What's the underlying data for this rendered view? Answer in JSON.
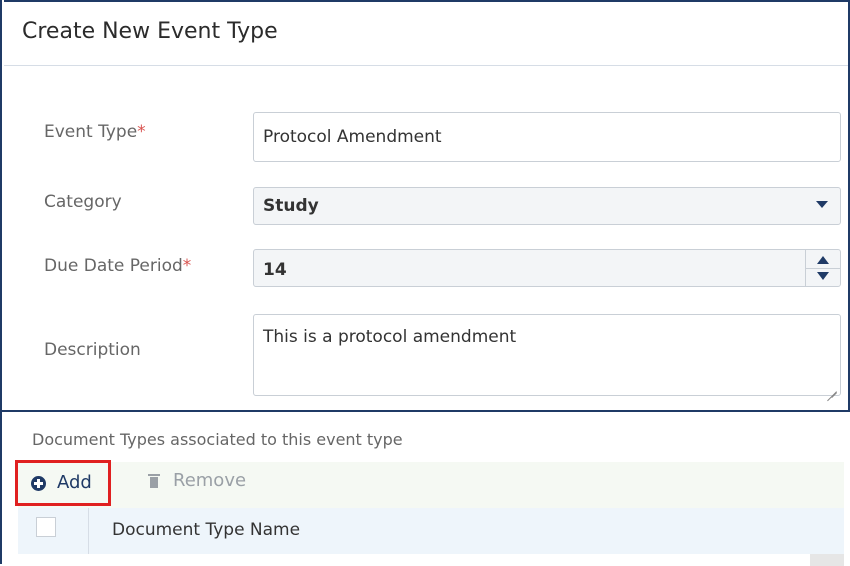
{
  "dialog": {
    "title": "Create New Event Type"
  },
  "form": {
    "event_type": {
      "label": "Event Type",
      "required_mark": "*",
      "value": "Protocol Amendment"
    },
    "category": {
      "label": "Category",
      "value": "Study"
    },
    "due_date_period": {
      "label": "Due Date Period",
      "required_mark": "*",
      "value": "14"
    },
    "description": {
      "label": "Description",
      "value": "This is a protocol amendment"
    }
  },
  "document_types": {
    "section_title": "Document Types associated to this event type",
    "toolbar": {
      "add_label": "Add",
      "remove_label": "Remove"
    },
    "grid": {
      "columns": [
        "Document Type Name"
      ]
    }
  },
  "colors": {
    "accent": "#1f3a66",
    "required": "#d9534f",
    "highlight_border": "#e02020"
  }
}
